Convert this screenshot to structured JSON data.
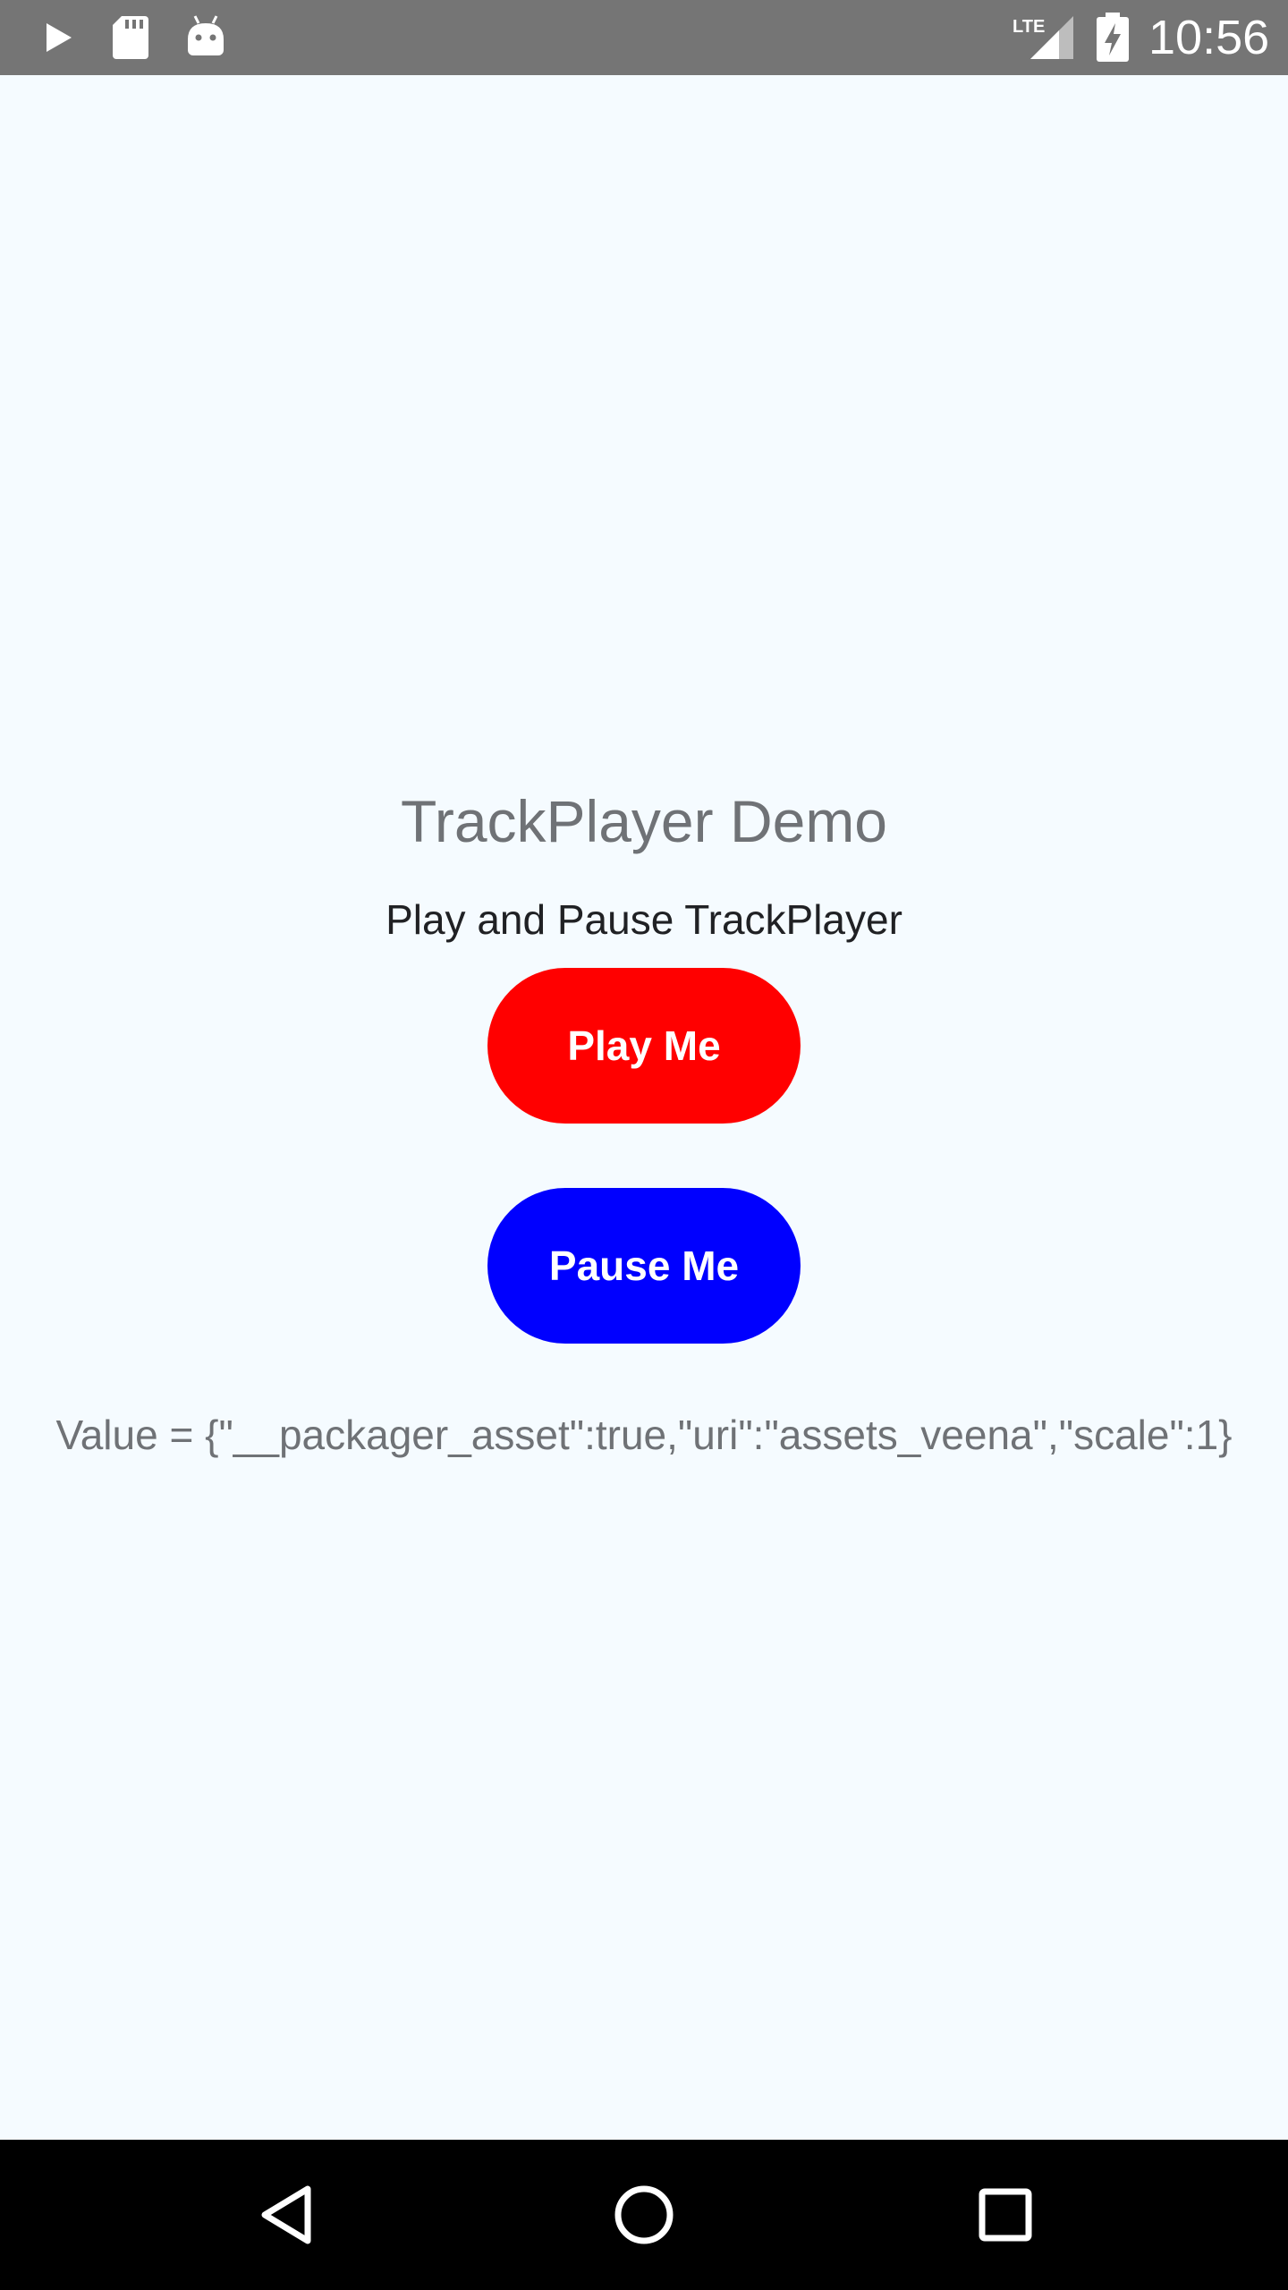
{
  "status_bar": {
    "time": "10:56",
    "network_label": "LTE",
    "icons": [
      "play-icon",
      "sd-card-icon",
      "android-icon",
      "lte-signal-icon",
      "battery-charging-icon"
    ]
  },
  "main": {
    "title": "TrackPlayer Demo",
    "subtitle": "Play and Pause TrackPlayer",
    "play_button_label": "Play Me",
    "pause_button_label": "Pause Me",
    "value_text": "Value = {\"__packager_asset\":true,\"uri\":\"assets_veena\",\"scale\":1}"
  },
  "colors": {
    "background": "#f5fbff",
    "status_bar": "#757575",
    "play_button": "#ff0000",
    "pause_button": "#0000ff",
    "nav_bar": "#000000"
  },
  "nav_bar": {
    "icons": [
      "back-icon",
      "home-icon",
      "recents-icon"
    ]
  }
}
